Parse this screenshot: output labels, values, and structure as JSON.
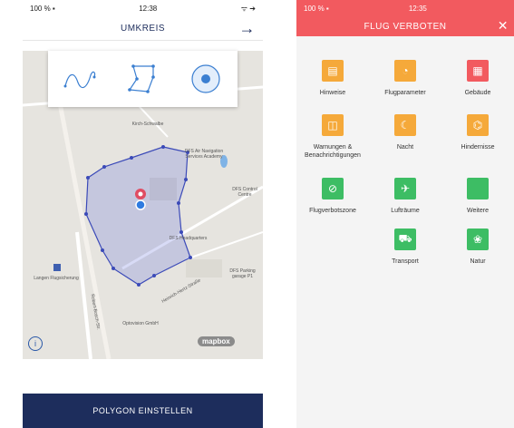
{
  "left": {
    "status": {
      "carrier": "100 % ▪",
      "time": "12:38",
      "icons": "ᯤ ➔"
    },
    "header": {
      "title": "UMKREIS",
      "back_icon": "→"
    },
    "map_labels": {
      "kirch": "Kirch-Schwalbe",
      "dfs_air": "DFS Air Navigation Services Academy",
      "dfs_control": "DFS Control Centre",
      "dfs_hq": "DFS Headquarters",
      "dfs_parking": "DFS Parking garage P1",
      "langen": "Langen Flugsicherung",
      "robert_bosch": "Robert-Bosch-Str.",
      "heinrich_hertz": "Heinrich-Hertz-Straße",
      "optovision": "Optovision GmbH",
      "mapbox": "mapbox"
    },
    "bottom_button": "POLYGON EINSTELLEN",
    "info_label": "i"
  },
  "right": {
    "status": {
      "carrier": "100 % ▪",
      "time": "12:35"
    },
    "header": {
      "title": "FLUG VERBOTEN",
      "close_icon": "✕"
    },
    "categories": [
      {
        "label": "Hinweise",
        "color": "#f5a93a",
        "icon": "document-icon"
      },
      {
        "label": "Flugparameter",
        "color": "#f5a93a",
        "icon": "gauge-icon"
      },
      {
        "label": "Gebäude",
        "color": "#f25a5f",
        "icon": "building-icon"
      },
      {
        "label": "Warnungen & Benachrichtigungen",
        "color": "#f5a93a",
        "icon": "bell-icon"
      },
      {
        "label": "Nacht",
        "color": "#f5a93a",
        "icon": "moon-icon"
      },
      {
        "label": "Hindernisse",
        "color": "#f5a93a",
        "icon": "obstacle-icon"
      },
      {
        "label": "Flugverbotszone",
        "color": "#3dbd64",
        "icon": "no-fly-icon"
      },
      {
        "label": "Lufträume",
        "color": "#3dbd64",
        "icon": "plane-icon"
      },
      {
        "label": "Weitere",
        "color": "#3dbd64",
        "icon": "more-icon"
      },
      {
        "label": "Transport",
        "color": "#3dbd64",
        "icon": "truck-icon"
      },
      {
        "label": "Natur",
        "color": "#3dbd64",
        "icon": "nature-icon"
      }
    ]
  }
}
